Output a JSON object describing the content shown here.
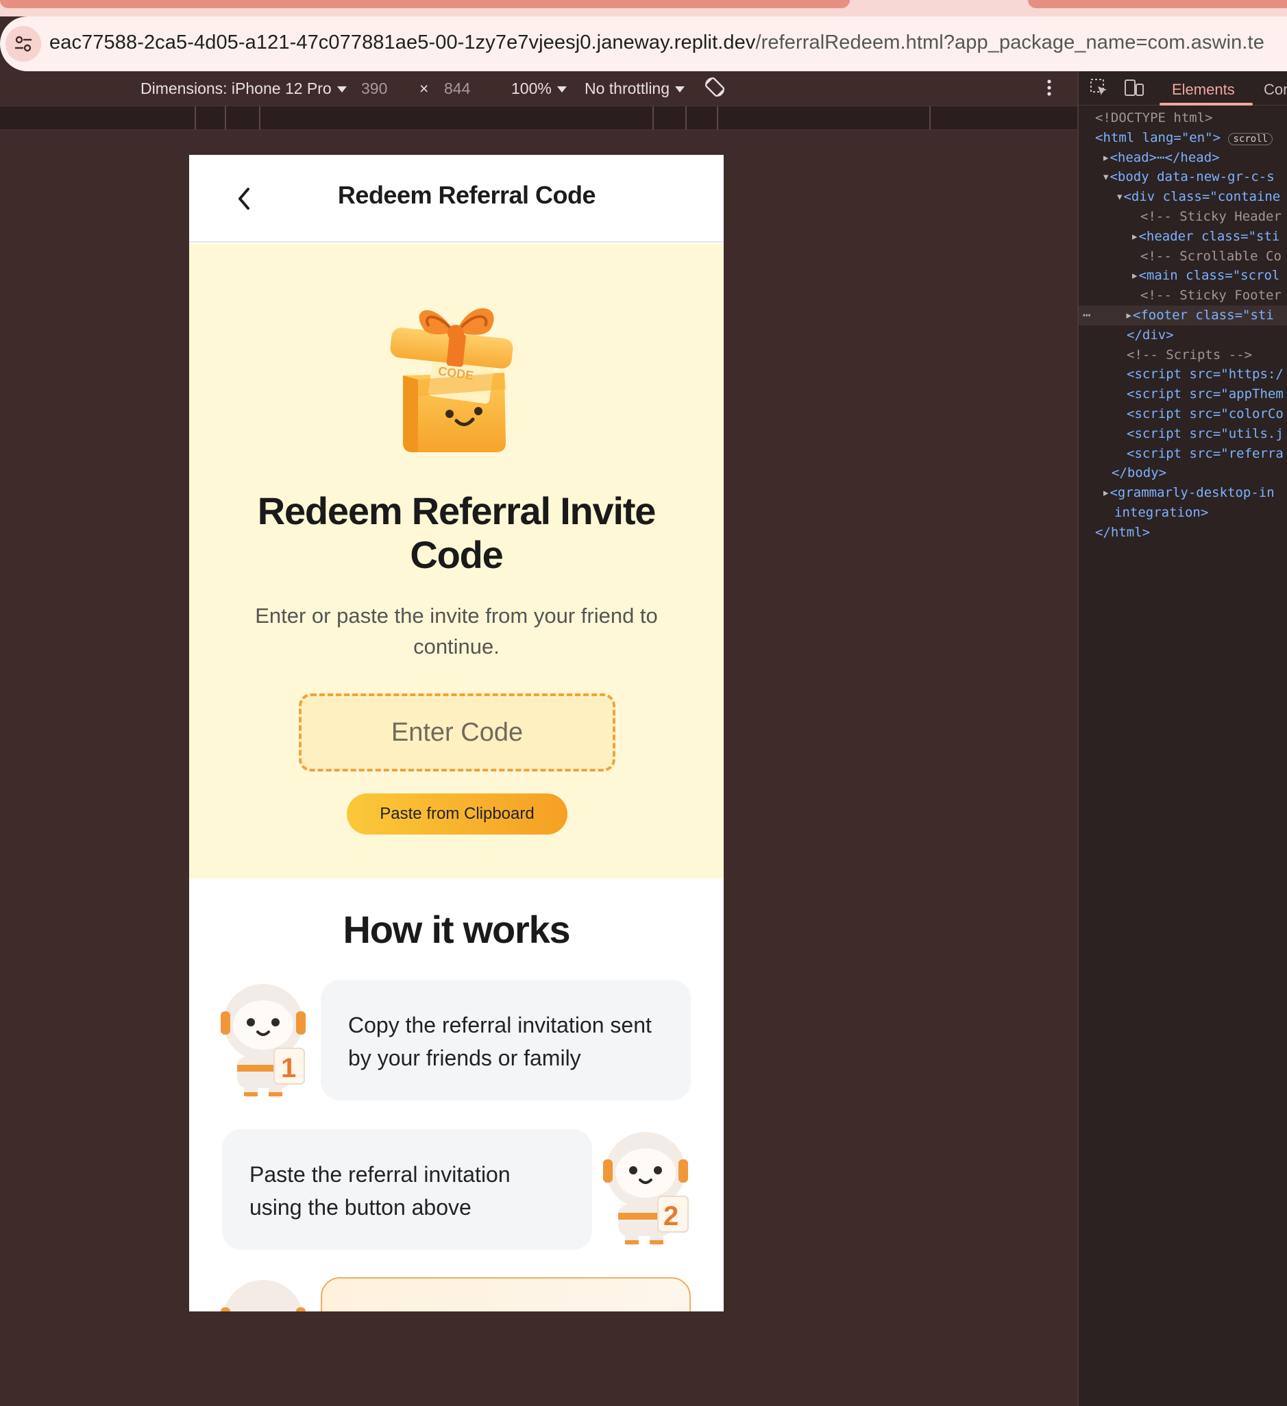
{
  "browser": {
    "url_host": "eac77588-2ca5-4d05-a121-47c077881ae5-00-1zy7e7vjeesj0.janeway.replit.dev",
    "url_path": "/referralRedeem.html?app_package_name=com.aswin.te"
  },
  "device_toolbar": {
    "dimensions_label": "Dimensions: iPhone 12 Pro",
    "width": "390",
    "times": "×",
    "height": "844",
    "zoom": "100%",
    "throttling": "No throttling"
  },
  "devtools": {
    "tabs": [
      "Elements",
      "Cor"
    ],
    "dom_lines": [
      "<!DOCTYPE html>",
      "<html lang=\"en\">",
      "<head>⋯</head>",
      "<body data-new-gr-c-s",
      "<div class=\"containe",
      "<!-- Sticky Header",
      "<header class=\"sti",
      "<!-- Scrollable Co",
      "<main class=\"scrol",
      "<!-- Sticky Footer",
      "<footer class=\"sti",
      "</div>",
      "<!-- Scripts -->",
      "<script src=\"https:/",
      "<script src=\"appThem",
      "<script src=\"colorCo",
      "<script src=\"utils.j",
      "<script src=\"referra",
      "</body>",
      "<grammarly-desktop-in",
      "integration>",
      "</html>"
    ],
    "scroll_badge": "scroll"
  },
  "app": {
    "header_title": "Redeem Referral Code",
    "hero_title": "Redeem Referral Invite Code",
    "hero_subtitle": "Enter or paste the invite from your friend to continue.",
    "code_placeholder": "Enter Code",
    "paste_button": "Paste from Clipboard",
    "gift_label": "CODE",
    "how_title": "How it works",
    "steps": [
      {
        "number": "1",
        "text": "Copy the referral invitation sent by your friends or family"
      },
      {
        "number": "2",
        "text": "Paste the referral invitation using the button above"
      }
    ]
  },
  "colors": {
    "hero_bg": "#fff8d6",
    "accent": "#f5a024",
    "input_border": "#f0a23a"
  }
}
